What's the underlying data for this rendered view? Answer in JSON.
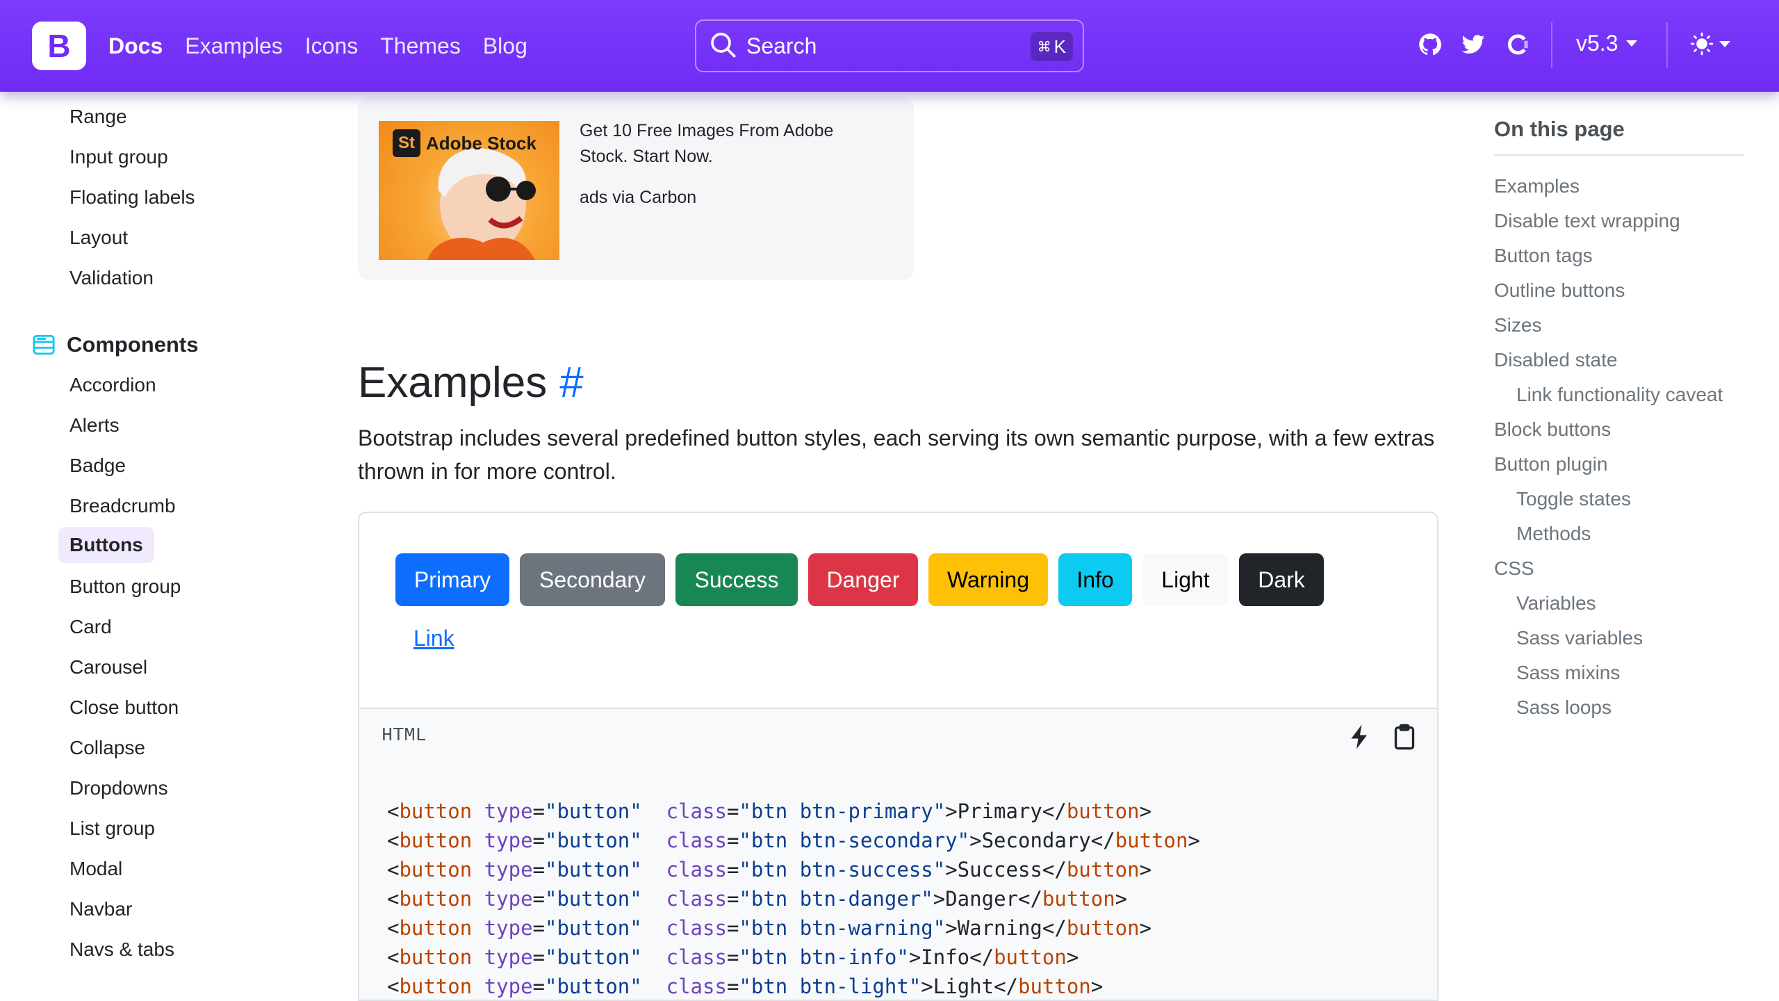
{
  "navbar": {
    "brand_letter": "B",
    "links": [
      {
        "label": "Docs",
        "active": true
      },
      {
        "label": "Examples",
        "active": false
      },
      {
        "label": "Icons",
        "active": false
      },
      {
        "label": "Themes",
        "active": false
      },
      {
        "label": "Blog",
        "active": false
      }
    ],
    "search": {
      "label": "Search",
      "shortcut_mod": "⌘",
      "shortcut_key": "K"
    },
    "icons": [
      "github-icon",
      "twitter-icon",
      "opencollective-icon"
    ],
    "version": "v5.3",
    "theme_icon": "sun-icon",
    "colors": {
      "brand": "#712cf9"
    }
  },
  "sidebar": {
    "forms_items": [
      "Range",
      "Input group",
      "Floating labels",
      "Layout",
      "Validation"
    ],
    "components_heading": "Components",
    "components_items": [
      "Accordion",
      "Alerts",
      "Badge",
      "Breadcrumb",
      "Buttons",
      "Button group",
      "Card",
      "Carousel",
      "Close button",
      "Collapse",
      "Dropdowns",
      "List group",
      "Modal",
      "Navbar",
      "Navs & tabs"
    ],
    "active_item": "Buttons"
  },
  "ad": {
    "brand_mark": "St",
    "brand_name": "Adobe Stock",
    "text": "Get 10 Free Images From Adobe Stock. Start Now.",
    "via": "ads via Carbon"
  },
  "main": {
    "heading": "Examples",
    "anchor": "#",
    "lead": "Bootstrap includes several predefined button styles, each serving its own semantic purpose, with a few extras thrown in for more control.",
    "buttons": [
      {
        "label": "Primary",
        "bg": "#0d6efd",
        "color": "#ffffff"
      },
      {
        "label": "Secondary",
        "bg": "#6c757d",
        "color": "#ffffff"
      },
      {
        "label": "Success",
        "bg": "#198754",
        "color": "#ffffff"
      },
      {
        "label": "Danger",
        "bg": "#dc3545",
        "color": "#ffffff"
      },
      {
        "label": "Warning",
        "bg": "#ffc107",
        "color": "#000000"
      },
      {
        "label": "Info",
        "bg": "#0dcaf0",
        "color": "#000000"
      },
      {
        "label": "Light",
        "bg": "#f8f9fa",
        "color": "#000000"
      },
      {
        "label": "Dark",
        "bg": "#212529",
        "color": "#ffffff"
      }
    ],
    "link_button": "Link",
    "code": {
      "lang": "HTML",
      "actions": [
        "lightning-icon",
        "clipboard-icon"
      ],
      "lines": [
        {
          "cls": "btn btn-primary",
          "text": "Primary"
        },
        {
          "cls": "btn btn-secondary",
          "text": "Secondary"
        },
        {
          "cls": "btn btn-success",
          "text": "Success"
        },
        {
          "cls": "btn btn-danger",
          "text": "Danger"
        },
        {
          "cls": "btn btn-warning",
          "text": "Warning"
        },
        {
          "cls": "btn btn-info",
          "text": "Info"
        },
        {
          "cls": "btn btn-light",
          "text": "Light"
        }
      ]
    }
  },
  "toc": {
    "title": "On this page",
    "items": [
      {
        "label": "Examples",
        "level": 1
      },
      {
        "label": "Disable text wrapping",
        "level": 1
      },
      {
        "label": "Button tags",
        "level": 1
      },
      {
        "label": "Outline buttons",
        "level": 1
      },
      {
        "label": "Sizes",
        "level": 1
      },
      {
        "label": "Disabled state",
        "level": 1
      },
      {
        "label": "Link functionality caveat",
        "level": 2
      },
      {
        "label": "Block buttons",
        "level": 1
      },
      {
        "label": "Button plugin",
        "level": 1
      },
      {
        "label": "Toggle states",
        "level": 2
      },
      {
        "label": "Methods",
        "level": 2
      },
      {
        "label": "CSS",
        "level": 1
      },
      {
        "label": "Variables",
        "level": 2
      },
      {
        "label": "Sass variables",
        "level": 2
      },
      {
        "label": "Sass mixins",
        "level": 2
      },
      {
        "label": "Sass loops",
        "level": 2
      }
    ]
  }
}
